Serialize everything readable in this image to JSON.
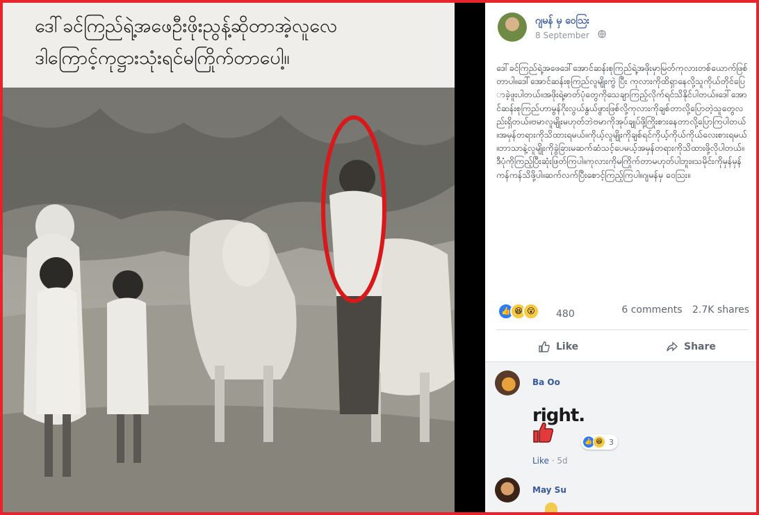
{
  "image_caption": {
    "line1": "ဒေါ်ခင်ကြည်ရဲ့အဖေဦးဖိုးညွန့်ဆိုတာအဲ့လူလေ",
    "line2": "ဒါကြောင့်ကုဋ္ဌားသုံးရင်မကြိုက်တာပေါ့။"
  },
  "post": {
    "author": "ဂျမန် မှ ဝေသြး",
    "date": "8 September",
    "privacy_icon": "globe-icon",
    "text": "ဒေါ်ခင်ကြည်ရဲ့အဖေဒေါ်အောင်ဆန်းစုကြည်ရဲ့အဖိုးမှာမြတ်ကုလားတစ်ယောက်ဖြစ်တာပါ။ဒေါ်အောင်ဆန်းစုကြည်လူမျိုးကွဲ ပြီး ကုလားကိုထိရှာနေလို့သူကိုယ်တိုင်ပြောခဲ့ဖူးပါတယ်။အဖိုးရဲ့ဓာတ်ပုံတွေကိုသေချာကြည့်လိုက်ရင်သိနိုင်ပါတယ်။ဒေါ်အောင်ဆန်းစုကြည်ဟာမွန်ဂိုးလွယ်နွယ်ဖွားဖြစ်လို့ကုလားကိုချစ်တာလို့ပြောတဲ့သူတွေလည်းရှိတယ်။ဗမာလူမျိုးမဟုတ်ဘဲဗမာကိုအုပ်ချုပ်ဖို့ကြိုးစားနေတာလို့ပြောကြပါတယ်။အမှန်တရားကိုသိထားရမယ်။ကိုယ့်လူမျိုးကိုချစ်ရင်ကိုယ့်ကိုယ်ကိုယ်လေးစားရမယ်။ဘာသာနဲ့လူမျိုးကိုခွဲခြားမဆက်ဆံသင့်ပေမယ့်အမှန်တရားကိုသိထားဖို့လိုပါတယ်။ဒီပုံကိုကြည့်ပြီးဆုံးဖြတ်ကြပါ။ကုလားကိုမကြိုက်တာမဟုတ်ပါဘူး။သမိုင်းကိုမှန်မှန်ကန်ကန်သိဖို့ပါ။ဆက်လက်ပြီးစောင့်ကြည့်ကြပါ။ဂျမန်မှ ဝေသြး။",
    "reaction_count": "480",
    "comments_count": "6 comments",
    "shares_count": "2.7K shares",
    "like_label": "Like",
    "share_label": "Share"
  },
  "comments": [
    {
      "author": "Ba Oo",
      "sticker_text": "right.",
      "reaction_count": "3",
      "like_label": "Like",
      "time": "5d"
    },
    {
      "author": "May Su"
    }
  ],
  "colors": {
    "frame": "#e8232a",
    "link": "#385898",
    "annotation_ellipse": "#d8191c"
  }
}
